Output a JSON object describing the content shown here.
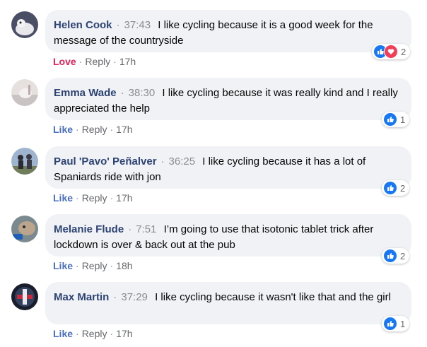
{
  "colors": {
    "bubble_bg": "#f0f2f5",
    "name": "#2d4373",
    "like_action": "#4b6fbf",
    "love_action": "#e0245e",
    "like_icon": "#1877f2",
    "love_icon": "#f33e58"
  },
  "comments": [
    {
      "author": "Helen Cook",
      "time": "37:43",
      "text": "I like cycling because it is a good week for the message of the countryside",
      "action": "Love",
      "reply": "Reply",
      "age": "17h",
      "reaction_count": "2",
      "reactions": [
        "like-icon",
        "love-icon"
      ]
    },
    {
      "author": "Emma Wade",
      "time": "38:30",
      "text": "I like cycling because it was really kind and I really appreciated the help",
      "action": "Like",
      "reply": "Reply",
      "age": "17h",
      "reaction_count": "1",
      "reactions": [
        "like-icon"
      ]
    },
    {
      "author": "Paul 'Pavo' Peñalver",
      "time": "36:25",
      "text": "I like cycling because it has a lot of Spaniards ride with jon",
      "action": "Like",
      "reply": "Reply",
      "age": "17h",
      "reaction_count": "2",
      "reactions": [
        "like-icon"
      ]
    },
    {
      "author": "Melanie Flude",
      "time": "7:51",
      "text": "I’m going to use that isotonic tablet trick after lockdown is over & back out at the pub",
      "action": "Like",
      "reply": "Reply",
      "age": "18h",
      "reaction_count": "2",
      "reactions": [
        "like-icon"
      ]
    },
    {
      "author": "Max Martin",
      "time": "37:29",
      "text": "I like cycling because it wasn't like that and the girl",
      "action": "Like",
      "reply": "Reply",
      "age": "17h",
      "reaction_count": "1",
      "reactions": [
        "like-icon"
      ]
    }
  ]
}
